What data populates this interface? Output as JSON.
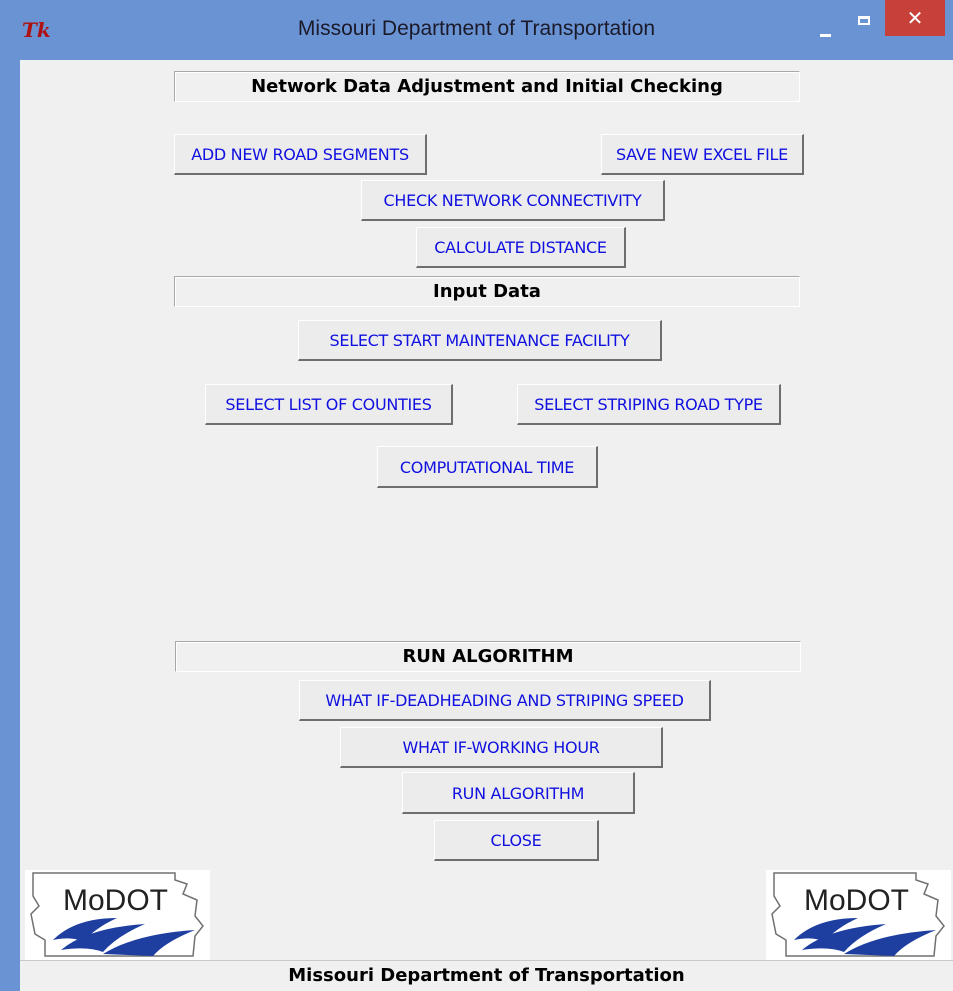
{
  "window": {
    "title": "Missouri Department of Transportation",
    "app_icon": "Tk",
    "controls": {
      "minimize_icon": "minimize-icon",
      "maximize_icon": "maximize-icon",
      "close_icon": "close-icon",
      "close_glyph": "✕"
    }
  },
  "sections": {
    "network": {
      "label": "Network Data Adjustment and Initial Checking",
      "buttons": {
        "add_segments": "ADD NEW ROAD SEGMENTS",
        "save_excel": "SAVE NEW EXCEL FILE",
        "check_connectivity": "CHECK NETWORK CONNECTIVITY",
        "calculate_distance": "CALCULATE DISTANCE"
      }
    },
    "input": {
      "label": "Input Data",
      "buttons": {
        "select_facility": "SELECT START MAINTENANCE FACILITY",
        "select_counties": "SELECT LIST OF COUNTIES",
        "select_road_type": "SELECT STRIPING ROAD TYPE",
        "computational_time": "COMPUTATIONAL TIME"
      }
    },
    "run": {
      "label": "RUN ALGORITHM",
      "buttons": {
        "what_if_speed": "WHAT IF-DEADHEADING AND STRIPING SPEED",
        "what_if_hour": "WHAT IF-WORKING HOUR",
        "run_algorithm": "RUN ALGORITHM",
        "close": "CLOSE"
      }
    }
  },
  "logo": {
    "text": "MoDOT"
  },
  "footer": {
    "text": "Missouri Department of Transportation"
  },
  "colors": {
    "titlebar": "#6a93d4",
    "button_text": "#1010e0",
    "close_button": "#c8403a",
    "background": "#f0f0f0"
  }
}
